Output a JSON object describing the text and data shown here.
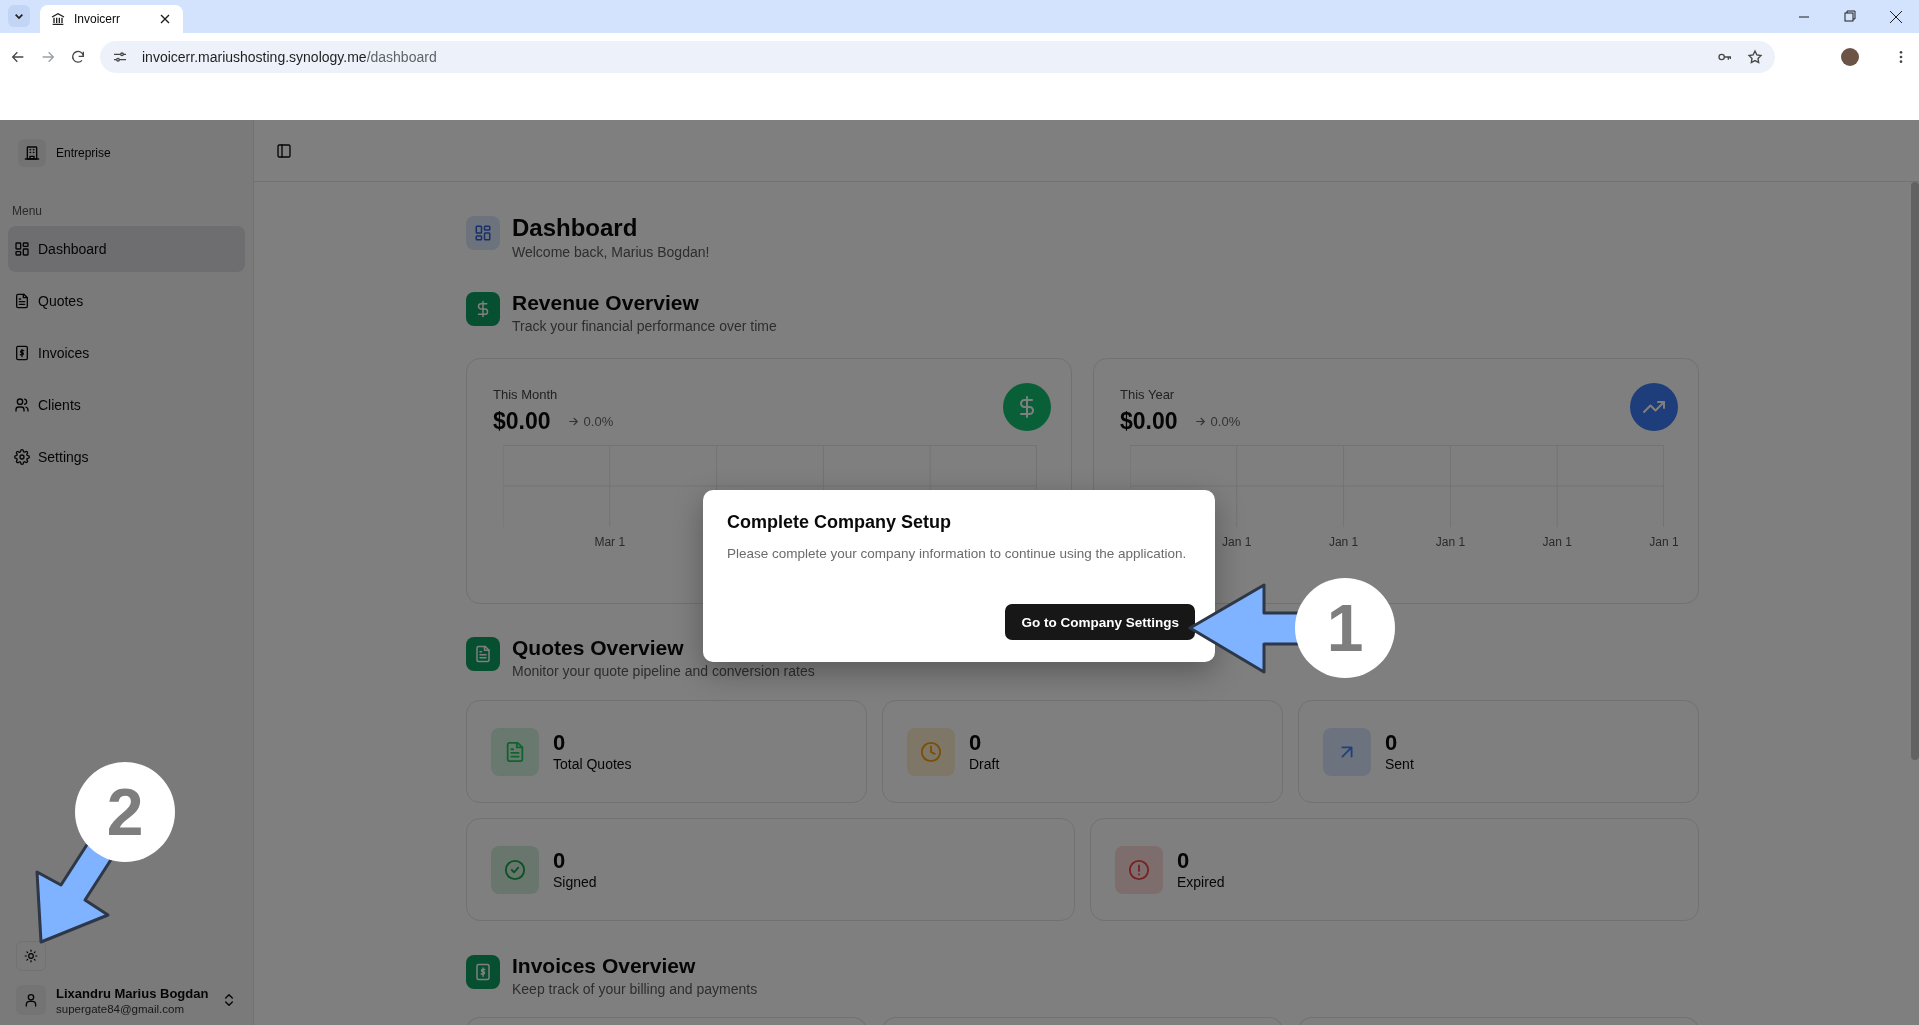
{
  "browser": {
    "tab_title": "Invoicerr",
    "url_host": "invoicerr.mariushosting.synology.me",
    "url_path": "/dashboard"
  },
  "sidebar": {
    "workspace": "Entreprise",
    "menu_label": "Menu",
    "items": [
      {
        "label": "Dashboard",
        "selected": true
      },
      {
        "label": "Quotes",
        "selected": false
      },
      {
        "label": "Invoices",
        "selected": false
      },
      {
        "label": "Clients",
        "selected": false
      },
      {
        "label": "Settings",
        "selected": false
      }
    ],
    "user": {
      "name": "Lixandru Marius Bogdan",
      "email": "supergate84@gmail.com"
    }
  },
  "header": {
    "title": "Dashboard",
    "subtitle": "Welcome back, Marius Bogdan!"
  },
  "revenue": {
    "title": "Revenue Overview",
    "subtitle": "Track your financial performance over time",
    "cards": [
      {
        "label": "This Month",
        "amount": "$0.00",
        "change": "0.0%",
        "x_labels": [
          "Mar 1"
        ]
      },
      {
        "label": "This Year",
        "amount": "$0.00",
        "change": "0.0%",
        "x_labels": [
          "Jan 1",
          "Jan 1",
          "Jan 1",
          "Jan 1",
          "Jan 1"
        ]
      }
    ]
  },
  "quotes": {
    "title": "Quotes Overview",
    "subtitle": "Monitor your quote pipeline and conversion rates",
    "stats": [
      {
        "value": "0",
        "label": "Total Quotes"
      },
      {
        "value": "0",
        "label": "Draft"
      },
      {
        "value": "0",
        "label": "Sent"
      },
      {
        "value": "0",
        "label": "Signed"
      },
      {
        "value": "0",
        "label": "Expired"
      }
    ]
  },
  "invoices": {
    "title": "Invoices Overview",
    "subtitle": "Keep track of your billing and payments"
  },
  "modal": {
    "title": "Complete Company Setup",
    "message": "Please complete your company information to continue using the application.",
    "button": "Go to Company Settings"
  },
  "annotations": [
    {
      "label": "1"
    },
    {
      "label": "2"
    }
  ]
}
